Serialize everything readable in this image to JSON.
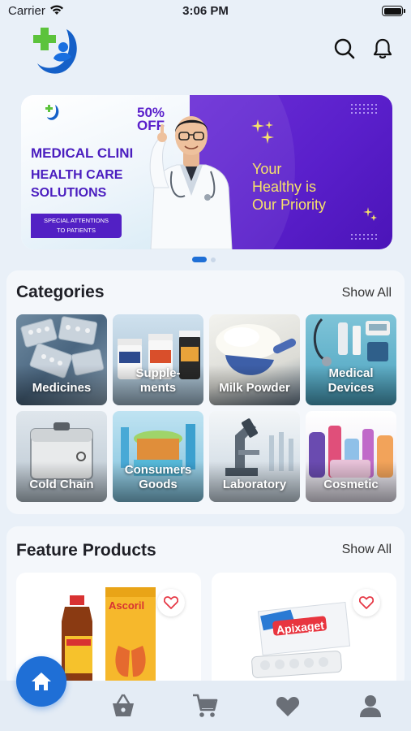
{
  "status_bar": {
    "carrier": "Carrier",
    "time": "3:06 PM"
  },
  "header": {
    "logo": "pharmacy-logo",
    "icons": [
      "search-icon",
      "bell-icon"
    ]
  },
  "banner": {
    "off_pct": "50%",
    "off_word": "OFF",
    "headline": "MEDICAL CLINI",
    "sub_line1": "HEALTH CARE",
    "sub_line2": "SOLUTIONS",
    "pill_line1": "SPECIAL ATTENTIONS",
    "pill_line2": "TO PATIENTS",
    "slogan_line1": "Your",
    "slogan_line2": "Healthy is",
    "slogan_line3": "Our Priority",
    "active_slide": 1,
    "slide_count": 2
  },
  "categories": {
    "title": "Categories",
    "show_all": "Show All",
    "items": [
      {
        "line1": "Medicines",
        "line2": ""
      },
      {
        "line1": "Supple-",
        "line2": "ments"
      },
      {
        "line1": "Milk Powder",
        "line2": ""
      },
      {
        "line1": "Medical",
        "line2": "Devices"
      },
      {
        "line1": "Cold Chain",
        "line2": ""
      },
      {
        "line1": "Consumers",
        "line2": "Goods"
      },
      {
        "line1": "Laboratory",
        "line2": ""
      },
      {
        "line1": "Cosmetic",
        "line2": ""
      }
    ]
  },
  "feature_products": {
    "title": "Feature Products",
    "show_all": "Show All",
    "items": [
      {
        "name": "Ascoril",
        "fav_icon": "heart-outline-icon"
      },
      {
        "name": "Apixaget",
        "fav_icon": "heart-outline-icon"
      }
    ]
  },
  "bottom_nav": {
    "items": [
      "home-icon",
      "basket-icon",
      "cart-icon",
      "heart-icon",
      "user-icon"
    ],
    "active": "home-icon"
  },
  "colors": {
    "primary": "#1f6fd6",
    "banner_purple": "#5a1fcb",
    "accent_red": "#e63946"
  }
}
